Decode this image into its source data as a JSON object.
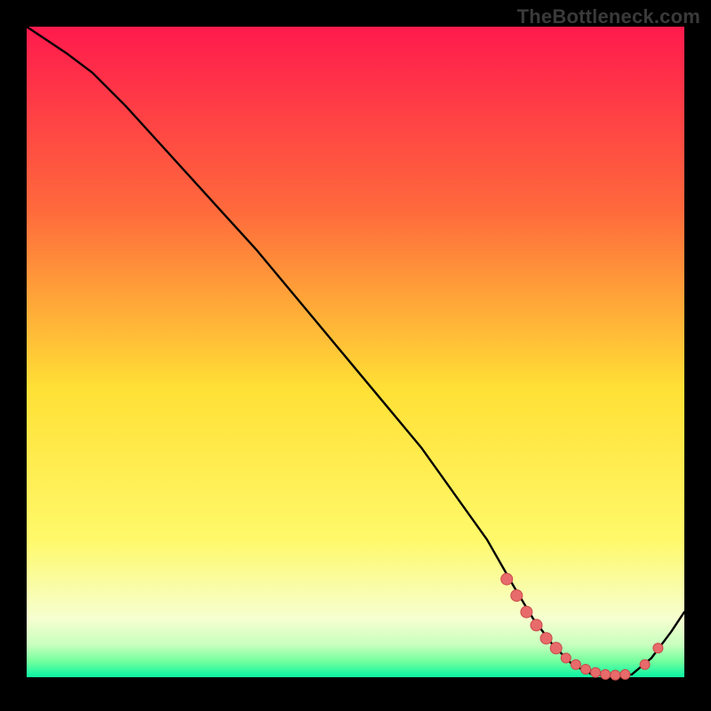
{
  "watermark": "TheBottleneck.com",
  "colors": {
    "bg": "#000000",
    "curve": "#000000",
    "dot_fill": "#e86b6b",
    "dot_stroke": "#c94a4a",
    "grad_top": "#ff1a4d",
    "grad_mid_upper": "#ff8a3a",
    "grad_mid": "#ffe035",
    "grad_lower": "#f8ffb0",
    "grad_bottom_band1": "#9dffad",
    "grad_bottom_band2": "#2fff92",
    "grad_bottom_band3": "#05f79f",
    "black": "#000000"
  },
  "chart_data": {
    "type": "line",
    "title": "",
    "xlabel": "",
    "ylabel": "",
    "xlim": [
      0,
      100
    ],
    "ylim": [
      0,
      100
    ],
    "series": [
      {
        "name": "bottleneck-curve",
        "x": [
          0,
          6,
          10,
          15,
          20,
          25,
          30,
          35,
          40,
          45,
          50,
          55,
          60,
          65,
          70,
          74,
          77,
          80,
          83,
          86,
          89,
          92,
          95,
          98,
          100
        ],
        "y": [
          100,
          96,
          93,
          88,
          82.5,
          77,
          71.5,
          66,
          60,
          54,
          48,
          42,
          36,
          29,
          22,
          15,
          10,
          6,
          3,
          1.5,
          1.3,
          1.5,
          4,
          8,
          11
        ]
      }
    ],
    "highlight_points": {
      "name": "range-dots",
      "x": [
        73,
        74.5,
        76,
        77.5,
        79,
        80.5,
        82,
        83.5,
        85,
        86.5,
        88,
        89.5,
        91,
        94,
        96
      ],
      "y": [
        16,
        13.5,
        11,
        9,
        7,
        5.5,
        4,
        3,
        2.3,
        1.8,
        1.5,
        1.4,
        1.5,
        3,
        5.5
      ]
    }
  }
}
